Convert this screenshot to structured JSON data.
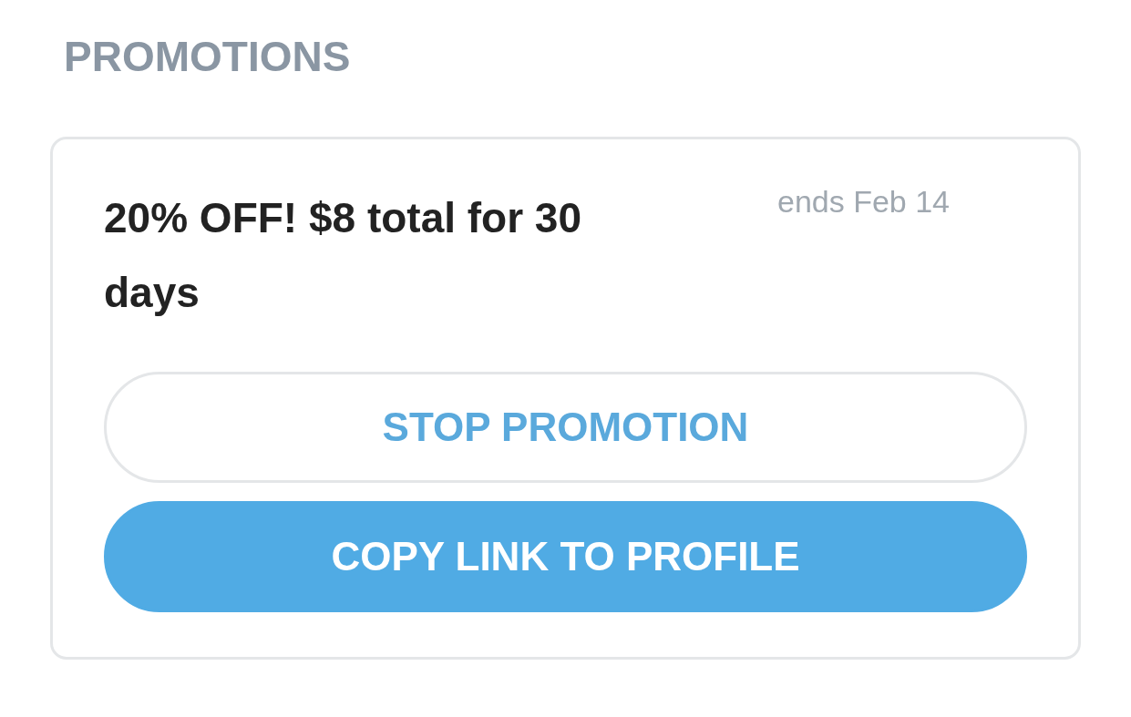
{
  "section_title": "PROMOTIONS",
  "promotion": {
    "offer": "20% OFF! **$8** total for 30 days",
    "ends": "ends Feb 14"
  },
  "buttons": [
    {
      "label": "STOP PROMOTION",
      "kind": "outline"
    },
    {
      "label": "COPY LINK TO PROFILE",
      "kind": "filled"
    }
  ]
}
